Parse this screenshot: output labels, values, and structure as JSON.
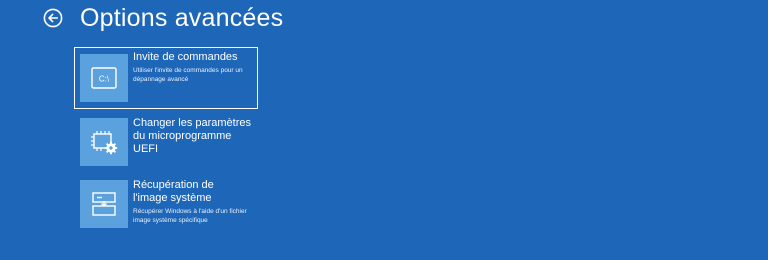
{
  "header": {
    "back_icon": "back-arrow-icon",
    "title": "Options avancées"
  },
  "options": [
    {
      "title": "Invite de commandes",
      "description": "Utiliser l'invite de commandes pour un dépannage avancé",
      "icon": "command-prompt-icon",
      "icon_text": "C:\\",
      "selected": true
    },
    {
      "title": "Changer les paramètres du microprogramme UEFI",
      "description": "",
      "icon": "uefi-chip-gear-icon",
      "selected": false
    },
    {
      "title": "Récupération de l'image système",
      "description": "Récupérer Windows à l'aide d'un fichier image système spécifique",
      "icon": "system-image-recovery-icon",
      "selected": false
    }
  ],
  "colors": {
    "background": "#1e66b8",
    "tile": "#5aa1dd",
    "text": "#ffffff"
  }
}
